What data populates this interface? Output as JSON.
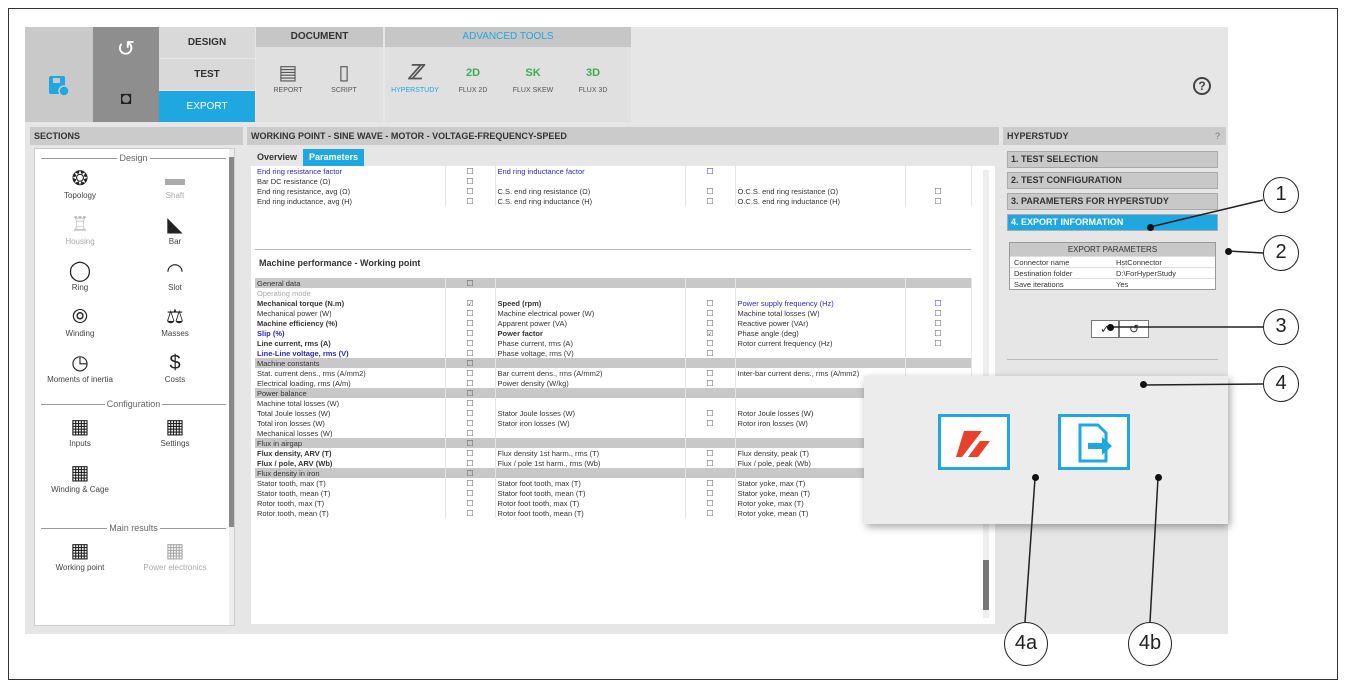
{
  "toolbar": {
    "mode": {
      "design": "DESIGN",
      "test": "TEST",
      "export": "EXPORT"
    },
    "document": {
      "title": "DOCUMENT",
      "report": "REPORT",
      "script": "SCRIPT"
    },
    "advanced": {
      "title": "ADVANCED TOOLS",
      "hyperstudy": "HYPERSTUDY",
      "flux2d": "FLUX 2D",
      "fluxskew": "FLUX SKEW",
      "flux3d": "FLUX 3D"
    }
  },
  "sections": {
    "title": "SECTIONS",
    "design_label": "Design",
    "configuration_label": "Configuration",
    "main_results_label": "Main results",
    "items": {
      "topology": "Topology",
      "shaft": "Shaft",
      "housing": "Housing",
      "bar": "Bar",
      "ring": "Ring",
      "slot": "Slot",
      "winding": "Winding",
      "masses": "Masses",
      "moments": "Moments of inertia",
      "costs": "Costs",
      "inputs": "Inputs",
      "settings": "Settings",
      "winding_cage": "Winding & Cage",
      "working_point": "Working point",
      "power_electronics": "Power electronics"
    }
  },
  "main": {
    "title": "WORKING POINT - SINE WAVE - MOTOR - VOLTAGE-FREQUENCY-SPEED",
    "tabs": {
      "overview": "Overview",
      "parameters": "Parameters"
    },
    "section_title": "Machine performance - Working point"
  },
  "hyperstudy": {
    "title": "HYPERSTUDY",
    "help": "?",
    "steps": [
      "1. TEST SELECTION",
      "2. TEST CONFIGURATION",
      "3. PARAMETERS FOR HYPERSTUDY",
      "4. EXPORT INFORMATION"
    ],
    "export_params": {
      "title": "EXPORT PARAMETERS",
      "rows": [
        {
          "label": "Connector name",
          "value": "HstConnector"
        },
        {
          "label": "Destination folder",
          "value": "D:\\ForHyperStudy"
        },
        {
          "label": "Save iterations",
          "value": "Yes"
        }
      ]
    }
  },
  "callouts": {
    "c1": "1",
    "c2": "2",
    "c3": "3",
    "c4": "4",
    "c4a": "4a",
    "c4b": "4b"
  },
  "icons": {
    "help": "?",
    "check": "✓",
    "undo": "↺",
    "camera": "◘"
  },
  "colors": {
    "accent": "#1ea7e1",
    "hyperstudy_red": "#e8412b",
    "flux_green": "#3cb04a"
  }
}
